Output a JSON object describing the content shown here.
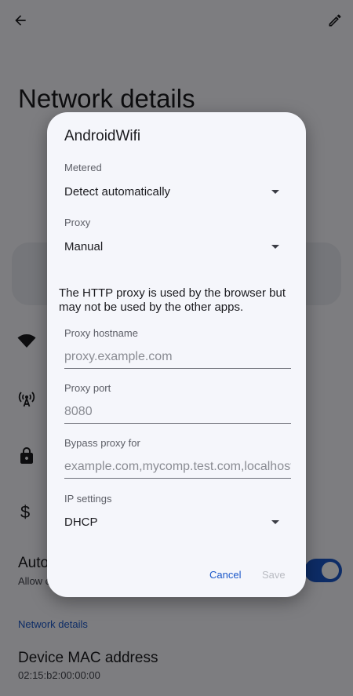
{
  "page": {
    "title": "Network details",
    "auto_title": "Auto",
    "auto_subtitle": "Allow c",
    "section_header": "Network details",
    "mac_label": "Device MAC address",
    "mac_value": "02:15:b2:00:00:00",
    "dollar_symbol": "$"
  },
  "icons": {
    "back": "arrow-left",
    "edit": "pencil",
    "wifi": "wifi",
    "signal": "antenna",
    "security": "lock",
    "metered": "dollar"
  },
  "dialog": {
    "title": "AndroidWifi",
    "metered": {
      "label": "Metered",
      "value": "Detect automatically"
    },
    "proxy": {
      "label": "Proxy",
      "value": "Manual"
    },
    "proxy_info": "The HTTP proxy is used by the browser but may not be used by the other apps.",
    "proxy_hostname": {
      "label": "Proxy hostname",
      "placeholder": "proxy.example.com",
      "value": ""
    },
    "proxy_port": {
      "label": "Proxy port",
      "placeholder": "8080",
      "value": ""
    },
    "bypass": {
      "label": "Bypass proxy for",
      "placeholder": "example.com,mycomp.test.com,localhost",
      "value": ""
    },
    "ip_settings": {
      "label": "IP settings",
      "value": "DHCP"
    },
    "cancel_label": "Cancel",
    "save_label": "Save"
  },
  "colors": {
    "accent": "#1a57c9",
    "disabled": "#b9bbc2",
    "surface": "#f5f6fb"
  }
}
